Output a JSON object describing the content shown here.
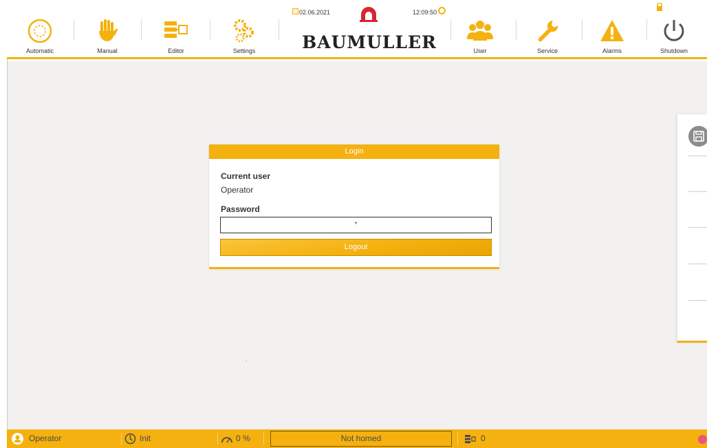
{
  "header": {
    "nav": [
      {
        "id": "automatic",
        "label": "Automatic",
        "icon": "automatic-circle-icon"
      },
      {
        "id": "manual",
        "label": "Manual",
        "icon": "hand-icon"
      },
      {
        "id": "editor",
        "label": "Editor",
        "icon": "editor-flow-icon"
      },
      {
        "id": "settings",
        "label": "Settings",
        "icon": "gears-icon"
      },
      {
        "id": "user",
        "label": "User",
        "icon": "users-icon"
      },
      {
        "id": "service",
        "label": "Service",
        "icon": "wrench-icon"
      },
      {
        "id": "alarms",
        "label": "Alarms",
        "icon": "warning-icon"
      },
      {
        "id": "shutdown",
        "label": "Shutdown",
        "icon": "power-icon"
      }
    ],
    "date": "02.06.2021",
    "time": "12:09:50",
    "brand": "BAUMULLER"
  },
  "login": {
    "title": "Login",
    "current_user_label": "Current user",
    "current_user_value": "Operator",
    "password_label": "Password",
    "password_value": "*",
    "logout_label": "Logout"
  },
  "statusbar": {
    "user": "Operator",
    "state": "Init",
    "override": "0 %",
    "homing": "Not homed",
    "program_count": "0"
  },
  "colors": {
    "accent": "#f4b10f",
    "brand_red": "#d7262e",
    "background": "#f2f1ef",
    "status_lamp": "#e9577a"
  }
}
